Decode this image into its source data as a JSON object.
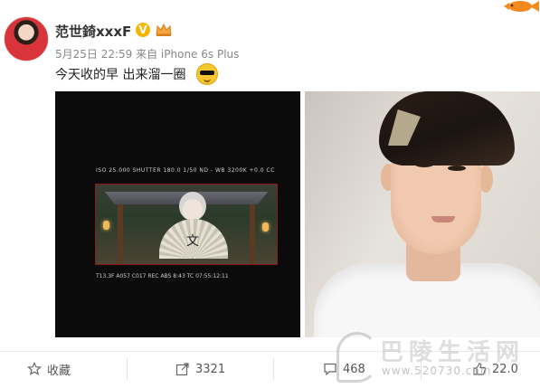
{
  "header": {
    "username": "范世錡xxxF",
    "verified_badge": "V",
    "meta": "5月25日 22:59 来自 iPhone 6s Plus"
  },
  "post": {
    "text": "今天收的早 出来溜一圈",
    "emoji": "sunglasses-emoji"
  },
  "monitor": {
    "top_readout": "ISO 25.000  SHUTTER 180.0   1/50  ND -  WB 3200K  +0.0 CC",
    "bottom_readout": "T13.3F  A057 C017 REC  ABS 8:43  TC 07:55:12:11",
    "fan_character": "文"
  },
  "actions": [
    {
      "icon": "star-icon",
      "label": "收藏"
    },
    {
      "icon": "share-icon",
      "label": "3321"
    },
    {
      "icon": "comment-icon",
      "label": "468"
    },
    {
      "icon": "like-icon",
      "label": "22.0"
    }
  ],
  "watermark": {
    "title": "巴陵生活网",
    "url": "www.520730.com"
  },
  "colors": {
    "accent": "#f7b500",
    "rec": "#e63b3b",
    "text_primary": "#222222",
    "text_meta": "#888888"
  }
}
